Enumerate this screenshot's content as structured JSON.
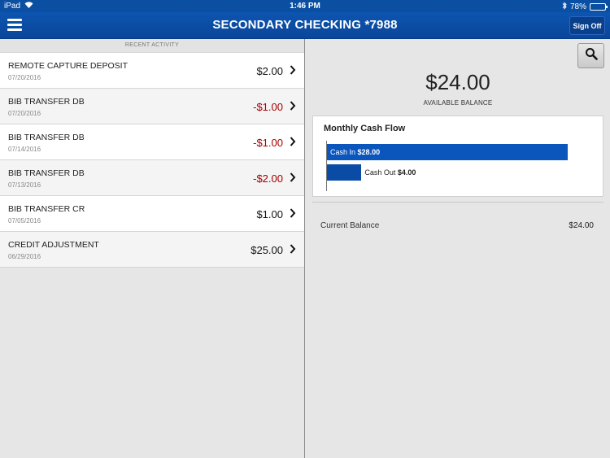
{
  "status": {
    "device": "iPad",
    "time": "1:46 PM",
    "battery": "78%",
    "battery_level": 0.78,
    "icons": [
      "wifi-icon",
      "bluetooth-icon",
      "battery-icon"
    ]
  },
  "header": {
    "title": "SECONDARY CHECKING *7988",
    "sign_off_label": "Sign Off"
  },
  "activity": {
    "section_title": "RECENT ACTIVITY",
    "items": [
      {
        "description": "REMOTE CAPTURE DEPOSIT",
        "date": "07/20/2016",
        "amount": "$2.00",
        "negative": false
      },
      {
        "description": "BIB TRANSFER DB",
        "date": "07/20/2016",
        "amount": "-$1.00",
        "negative": true
      },
      {
        "description": "BIB TRANSFER DB",
        "date": "07/14/2016",
        "amount": "-$1.00",
        "negative": true
      },
      {
        "description": "BIB TRANSFER DB",
        "date": "07/13/2016",
        "amount": "-$2.00",
        "negative": true
      },
      {
        "description": "BIB TRANSFER CR",
        "date": "07/05/2016",
        "amount": "$1.00",
        "negative": false
      },
      {
        "description": "CREDIT ADJUSTMENT",
        "date": "06/29/2016",
        "amount": "$25.00",
        "negative": false
      }
    ]
  },
  "summary": {
    "available_balance": "$24.00",
    "available_label": "AVAILABLE BALANCE",
    "current_balance_label": "Current Balance",
    "current_balance_value": "$24.00"
  },
  "chart_data": {
    "type": "bar",
    "orientation": "horizontal",
    "title": "Monthly Cash Flow",
    "categories": [
      "Cash In",
      "Cash Out"
    ],
    "values": [
      28.0,
      4.0
    ],
    "value_labels": [
      "$28.00",
      "$4.00"
    ],
    "colors": [
      "#0b56bd",
      "#0a4ca5"
    ],
    "xlim": [
      0,
      29
    ]
  },
  "colors": {
    "brand": "#0b4fa3",
    "negative_amount": "#a40000"
  }
}
